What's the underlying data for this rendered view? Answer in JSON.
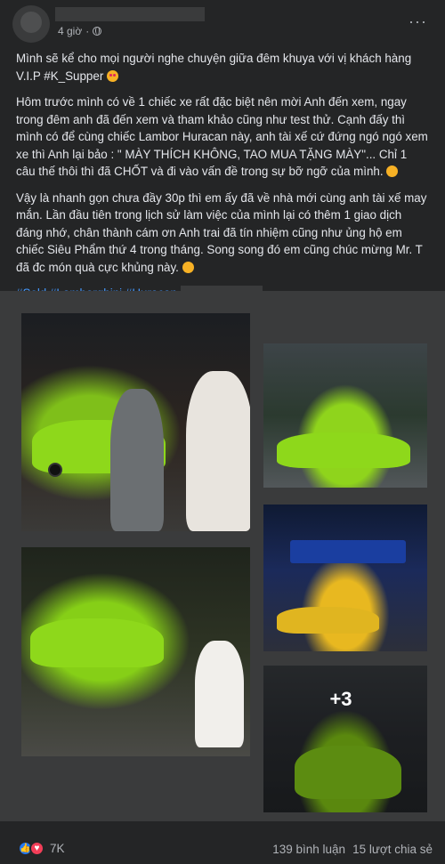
{
  "header": {
    "time": "4 giờ",
    "more_label": "···"
  },
  "post": {
    "paragraphs": [
      "Mình sẽ kể cho mọi người nghe chuyện giữa đêm khuya với vị khách hàng V.I.P #K_Supper",
      "Hôm trước mình có về 1 chiếc xe rất đặc biệt nên mời Anh đến xem, ngay trong đêm anh đã đến xem và tham khảo cũng như test thử. Cạnh đấy thì mình có để cùng chiếc Lambor Huracan này, anh tài xế cứ đứng ngó ngó xem xe thì Anh lại bảo : \" MÀY THÍCH KHÔNG, TAO MUA TẶNG MÀY\"... Chỉ 1 câu thế thôi thì đã CHỐT và đi vào vấn đề trong sự bỡ ngỡ của mình.",
      "Vậy là nhanh gọn chưa đầy 30p thì em ấy đã về nhà mới cùng anh tài xế may mắn. Lần đầu tiên trong lịch sử làm việc của mình lại có thêm 1 giao dịch đáng nhớ, chân thành cám ơn Anh trai đã tín nhiệm cũng như ủng hộ em chiếc Siêu Phẩm thứ 4 trong tháng. Song song đó em cũng chúc mừng Mr. T đã đc món quà cực khủng này."
    ],
    "hashtags": [
      "#Sold",
      "#Lamborghini",
      "#Huracan"
    ]
  },
  "gallery": {
    "more_count": "+3"
  },
  "footer": {
    "reactions": "7K",
    "comments": "139 bình luận",
    "shares": "15 lượt chia sẻ"
  },
  "colors": {
    "background": "#242526",
    "text": "#e4e6eb",
    "secondary": "#b0b3b8",
    "hashtag": "#4599ff",
    "like": "#2078f4",
    "love": "#f33e58"
  }
}
